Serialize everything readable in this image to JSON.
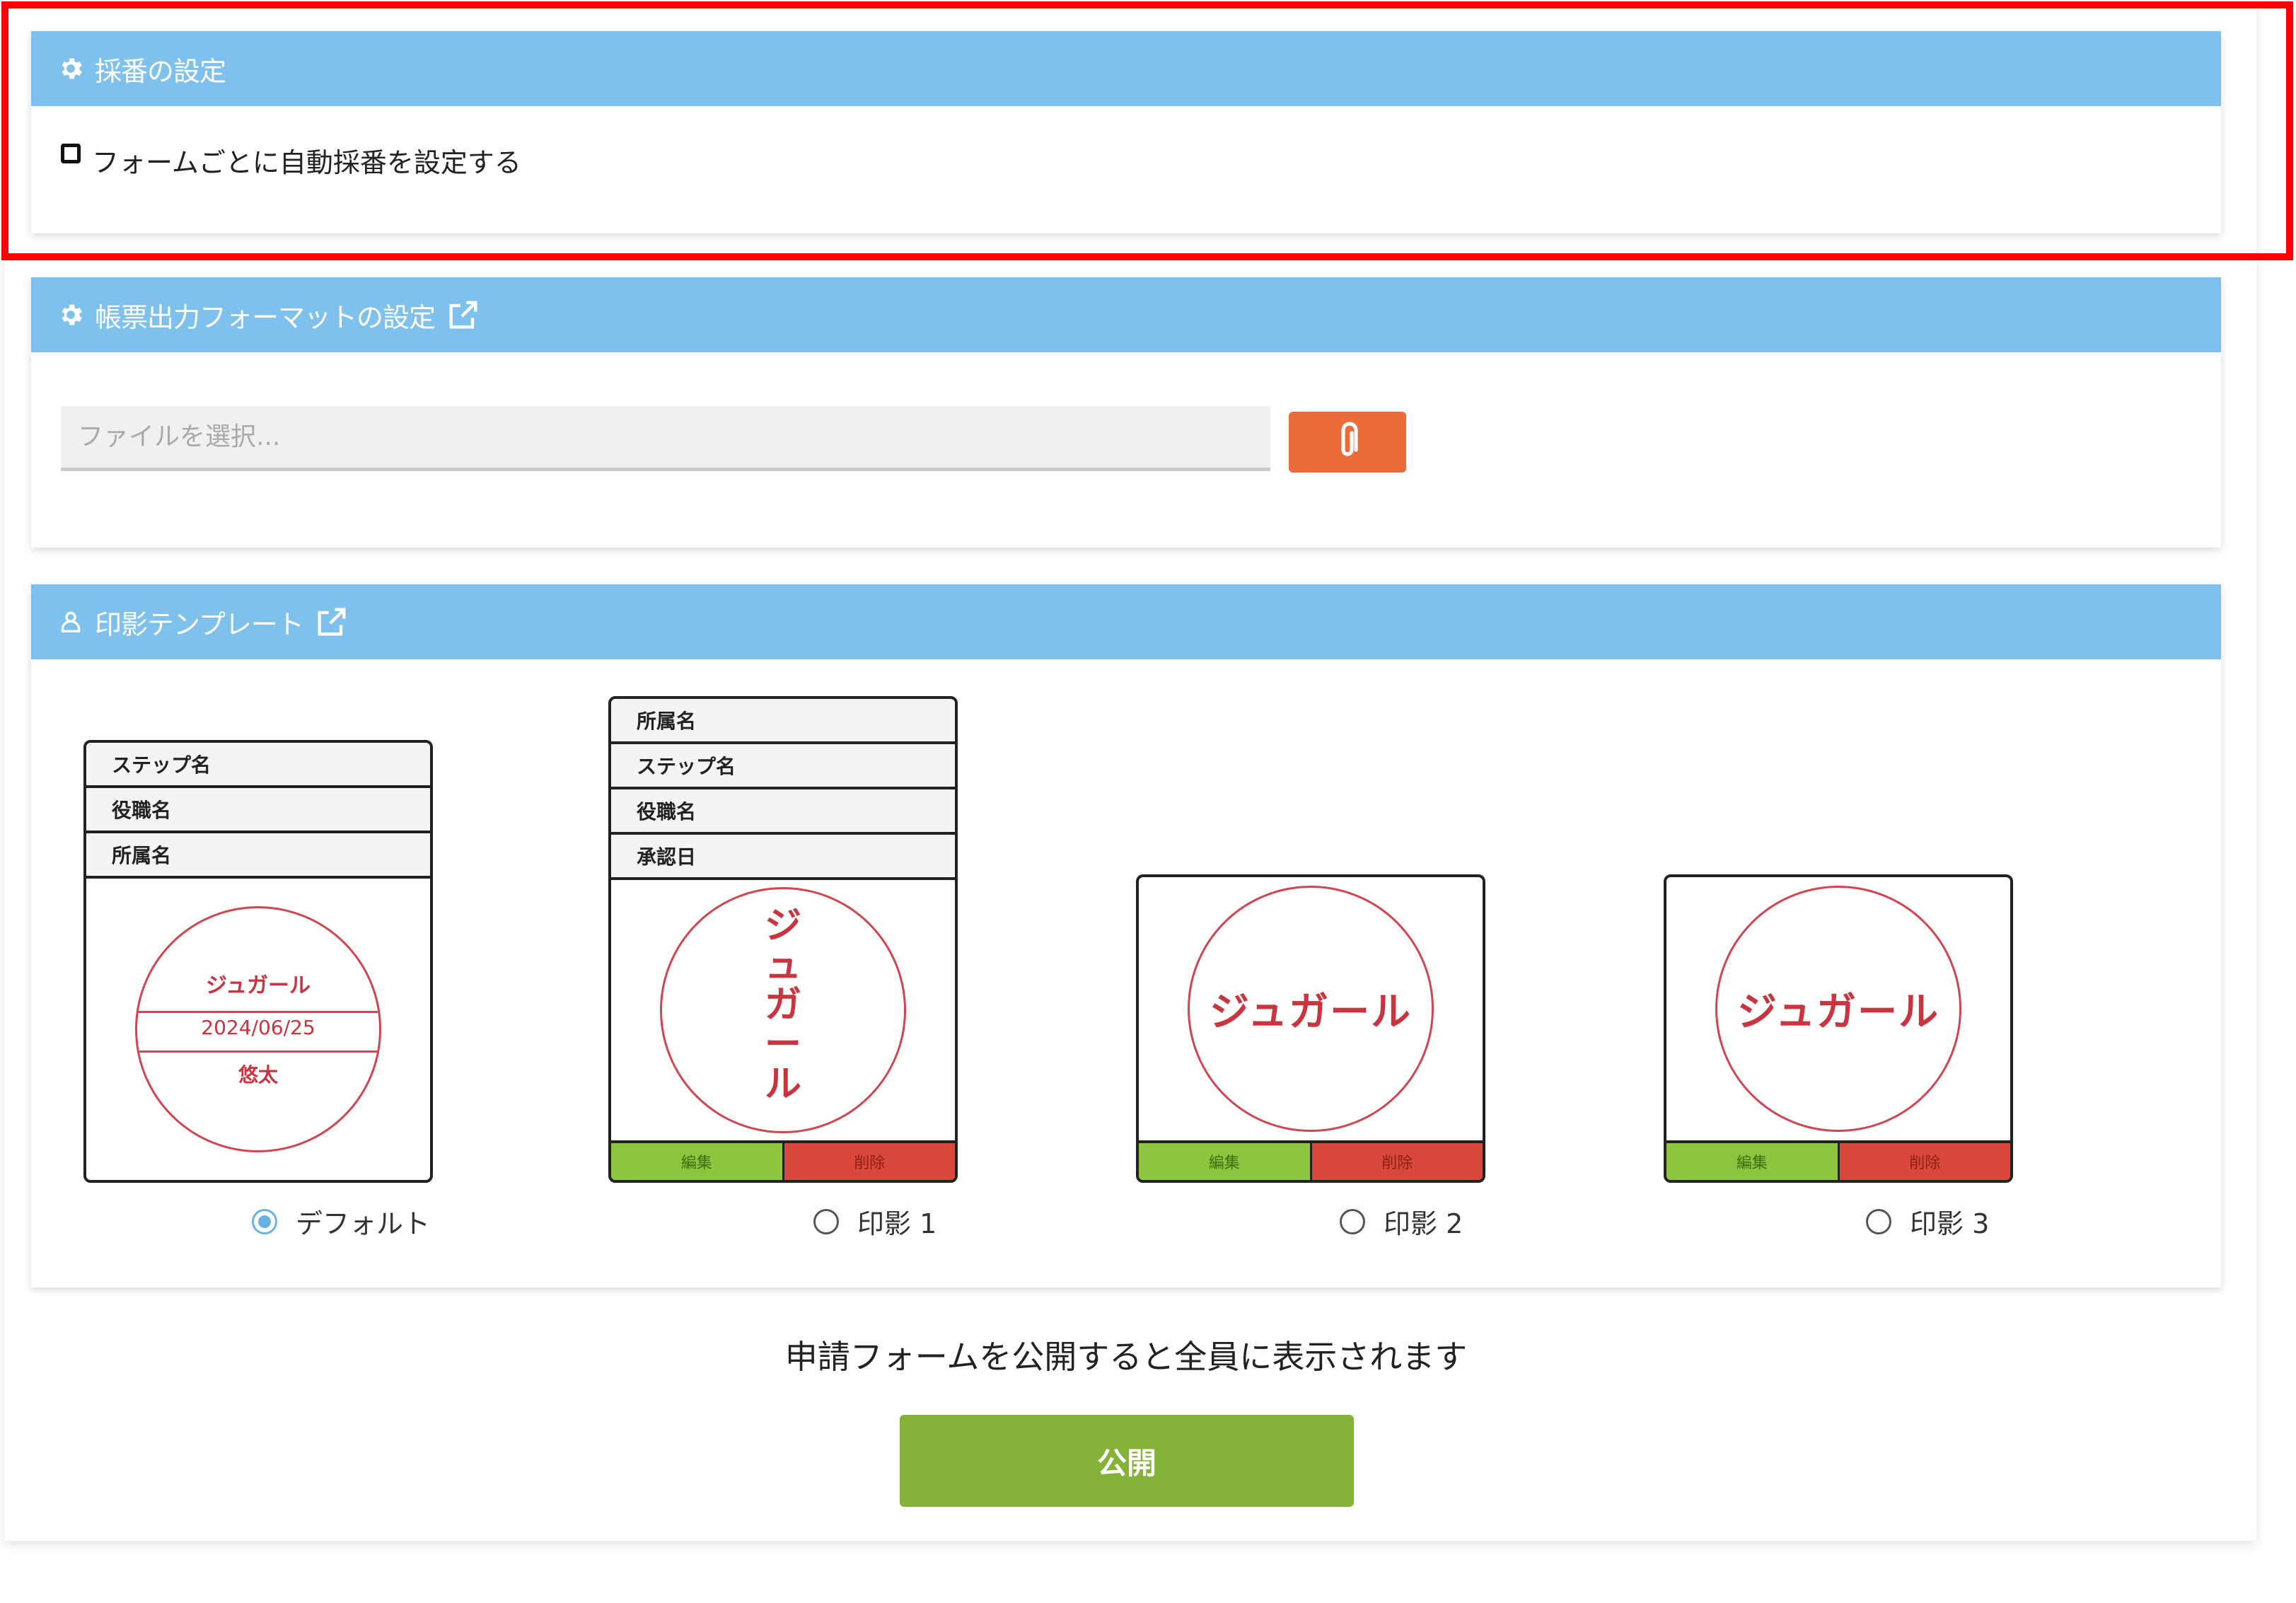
{
  "numbering": {
    "title": "採番の設定",
    "checkbox_label": "フォームごとに自動採番を設定する",
    "checked": false
  },
  "format": {
    "title": "帳票出力フォーマットの設定",
    "file_placeholder": "ファイルを選択..."
  },
  "stamp": {
    "title": "印影テンプレート",
    "default_card": {
      "rows": [
        "ステップ名",
        "役職名",
        "所属名"
      ],
      "top_text": "ジュガール",
      "date_text": "2024/06/25",
      "bottom_text": "悠太",
      "option_label": "デフォルト"
    },
    "card1": {
      "rows": [
        "所属名",
        "ステップ名",
        "役職名",
        "承認日"
      ],
      "vertical_chars": [
        "ジ",
        "ュ",
        "ガ",
        "ー",
        "ル"
      ],
      "option_label": "印影 1"
    },
    "card2": {
      "name": "ジュガール",
      "option_label": "印影 2"
    },
    "card3": {
      "name": "ジュガール",
      "option_label": "印影 3"
    },
    "edit_label": "編集",
    "delete_label": "削除",
    "selected": "デフォルト"
  },
  "publish": {
    "note": "申請フォームを公開すると全員に表示されます",
    "button_label": "公開"
  },
  "colors": {
    "header": "#7dc1ec",
    "attach": "#ed6a3b",
    "publish": "#84b237",
    "stamp_red": "#c9343f",
    "edit_green": "#8cc63f",
    "delete_red": "#d9473d",
    "highlight": "#ff0000"
  }
}
